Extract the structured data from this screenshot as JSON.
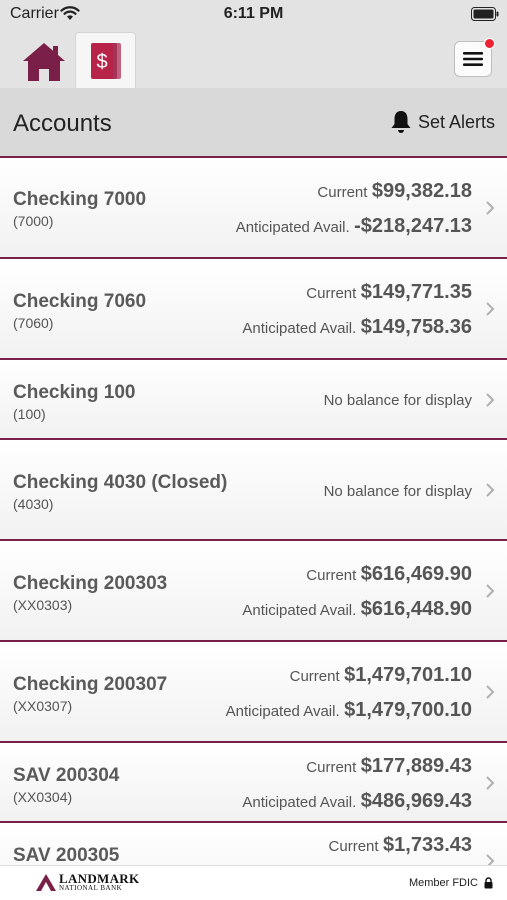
{
  "status_bar": {
    "carrier": "Carrier",
    "time": "6:11 PM"
  },
  "nav": {
    "tabs": [
      {
        "name": "home",
        "icon": "house-icon"
      },
      {
        "name": "accounts",
        "icon": "dollar-cards-icon",
        "active": true
      }
    ],
    "menu_notification": true
  },
  "header": {
    "title": "Accounts",
    "alerts_label": "Set Alerts"
  },
  "accounts": [
    {
      "name": "Checking 7000",
      "number": "(7000)",
      "current_label": "Current",
      "current": "$99,382.18",
      "anticipated_label": "Anticipated Avail.",
      "anticipated": "-$218,247.13"
    },
    {
      "name": "Checking 7060",
      "number": "(7060)",
      "current_label": "Current",
      "current": "$149,771.35",
      "anticipated_label": "Anticipated Avail.",
      "anticipated": "$149,758.36"
    },
    {
      "name": "Checking 100",
      "number": "(100)",
      "no_balance": "No balance for display"
    },
    {
      "name": "Checking 4030 (Closed)",
      "number": "(4030)",
      "no_balance": "No balance for display"
    },
    {
      "name": "Checking 200303",
      "number": "(XX0303)",
      "current_label": "Current",
      "current": "$616,469.90",
      "anticipated_label": "Anticipated Avail.",
      "anticipated": "$616,448.90"
    },
    {
      "name": "Checking 200307",
      "number": "(XX0307)",
      "current_label": "Current",
      "current": "$1,479,701.10",
      "anticipated_label": "Anticipated Avail.",
      "anticipated": "$1,479,700.10"
    },
    {
      "name": "SAV 200304",
      "number": "(XX0304)",
      "current_label": "Current",
      "current": "$177,889.43",
      "anticipated_label": "Anticipated Avail.",
      "anticipated": "$486,969.43"
    },
    {
      "name": "SAV 200305",
      "current_label": "Current",
      "current": "$1,733.43"
    }
  ],
  "footer": {
    "brand_name": "LANDMARK",
    "brand_sub": "NATIONAL BANK",
    "member_label": "Member FDIC"
  },
  "colors": {
    "brand": "#7a1f48",
    "accent_red": "#b8234a",
    "bar_gray": "#e3e3e3"
  }
}
